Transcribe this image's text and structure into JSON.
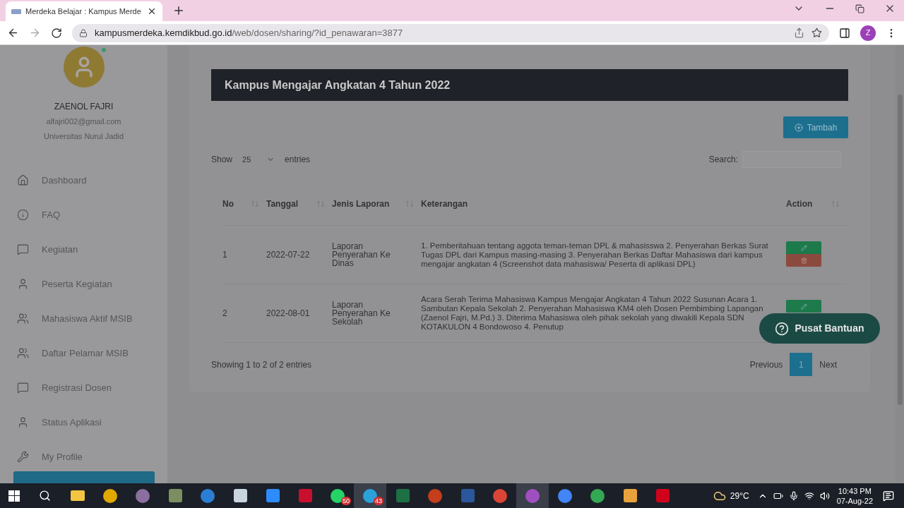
{
  "browser": {
    "tab_title": "Merdeka Belajar : Kampus Merde",
    "url_host": "kampusmerdeka.kemdikbud.go.id",
    "url_path": "/web/dosen/sharing/?id_penawaran=3877",
    "profile_initial": "Z"
  },
  "user": {
    "name": "ZAENOL FAJRI",
    "email": "alfajri002@gmail.com",
    "university": "Universitas Nurul Jadid",
    "online": true
  },
  "sidebar": {
    "items": [
      {
        "label": "Dashboard",
        "kind": "home"
      },
      {
        "label": "FAQ",
        "kind": "info"
      },
      {
        "label": "Kegiatan",
        "kind": "chat"
      },
      {
        "label": "Peserta Kegiatan",
        "kind": "person"
      },
      {
        "label": "Mahasiswa Aktif MSIB",
        "kind": "people"
      },
      {
        "label": "Daftar Pelamar MSIB",
        "kind": "people"
      },
      {
        "label": "Registrasi Dosen",
        "kind": "chat"
      },
      {
        "label": "Status Aplikasi",
        "kind": "person"
      },
      {
        "label": "My Profile",
        "kind": "wrench"
      }
    ]
  },
  "page": {
    "title": "Kampus Mengajar Angkatan 4 Tahun 2022",
    "add_button": "Tambah",
    "show_label": "Show",
    "entries_value": "25",
    "entries_label": "entries",
    "search_label": "Search:"
  },
  "table": {
    "columns": [
      "No",
      "Tanggal",
      "Jenis Laporan",
      "Keterangan",
      "Action"
    ],
    "rows": [
      {
        "no": "1",
        "date": "2022-07-22",
        "type": "Laporan Penyerahan Ke Dinas",
        "note": "1. Pemberitahuan tentang aggota teman-teman DPL & mahasisswa 2. Penyerahan Berkas Surat Tugas DPL dari Kampus masing-masing 3. Penyerahan Berkas Daftar Mahasiswa dari kampus mengajar angkatan 4 (Screenshot data mahasiswa/ Peserta di aplikasi DPL)",
        "actions": [
          {
            "kind": "edit"
          },
          {
            "kind": "delete"
          }
        ]
      },
      {
        "no": "2",
        "date": "2022-08-01",
        "type": "Laporan Penyerahan Ke Sekolah",
        "note": "Acara Serah Terima Mahasiswa Kampus Mengajar Angkatan 4 Tahun 2022 Susunan Acara 1. Sambutan Kepala Sekolah 2. Penyerahan Mahasiswa KM4 oleh Dosen Pembimbing Lapangan (Zaenol Fajri, M.Pd.) 3. Diterima Mahasiswa oleh pihak sekolah yang diwakili Kepala SDN KOTAKULON 4 Bondowoso 4. Penutup",
        "actions": [
          {
            "kind": "edit"
          }
        ]
      }
    ],
    "info": "Showing 1 to 2 of 2 entries"
  },
  "pagination": {
    "previous": "Previous",
    "pages": [
      {
        "label": "1",
        "selected": true
      }
    ],
    "next": "Next"
  },
  "help_button": "Pusat Bantuan",
  "taskbar": {
    "apps": [
      {
        "kind": "folder",
        "color": "#f4c542",
        "active": false
      },
      {
        "kind": "circle",
        "color": "#e0a800",
        "active": false
      },
      {
        "kind": "circle",
        "color": "#8a6fa0",
        "active": false
      },
      {
        "kind": "square",
        "color": "#7a8f60",
        "active": false
      },
      {
        "kind": "circle",
        "color": "#2a7fd4",
        "active": false
      },
      {
        "kind": "square",
        "color": "#c8d4e0",
        "active": false
      },
      {
        "kind": "square",
        "color": "#2d8cff",
        "active": false
      },
      {
        "kind": "square",
        "color": "#c8102e",
        "active": false
      },
      {
        "kind": "circle",
        "color": "#25d366",
        "badge": "50",
        "active": false
      },
      {
        "kind": "circle",
        "color": "#2aa1da",
        "badge": "43",
        "active": true
      },
      {
        "kind": "square",
        "color": "#1d7044",
        "active": false
      },
      {
        "kind": "circle",
        "color": "#c43e1c",
        "active": false
      },
      {
        "kind": "square",
        "color": "#2b579a",
        "active": false
      },
      {
        "kind": "circle",
        "color": "#db4437",
        "active": false
      },
      {
        "kind": "circle",
        "color": "#a04fc0",
        "active": true
      },
      {
        "kind": "circle",
        "color": "#4285f4",
        "active": false
      },
      {
        "kind": "circle",
        "color": "#34a853",
        "active": false
      },
      {
        "kind": "square",
        "color": "#e8a23c",
        "active": false
      },
      {
        "kind": "square",
        "color": "#d0021b",
        "active": false
      }
    ],
    "temperature": "29°C",
    "time": "10:43 PM",
    "date": "07-Aug-22"
  }
}
